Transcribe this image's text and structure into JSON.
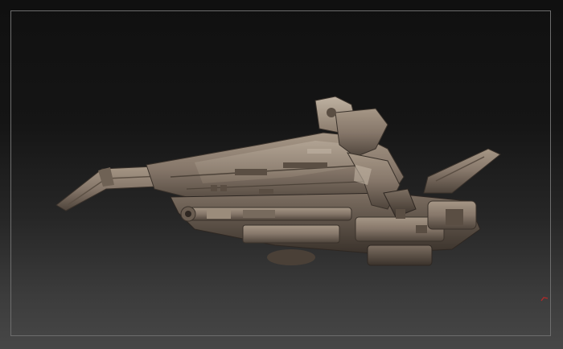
{
  "viewport": {
    "background_top": "#111111",
    "background_bottom": "#474747",
    "frame_color": "#6d6d6d"
  },
  "model": {
    "icon": "mech-hover-bike-sculpt",
    "material_color": "#8a7b6c",
    "shadow_color": "#3e352d",
    "highlight_color": "#b3a595"
  },
  "corner_marker": {
    "icon": "red-axis-marker-icon",
    "color": "#b12a2a"
  }
}
